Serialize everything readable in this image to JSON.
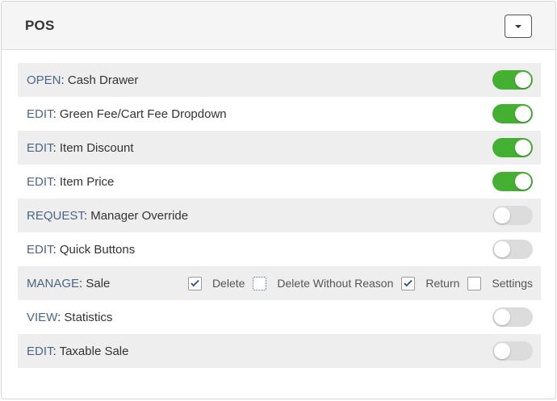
{
  "panel": {
    "title": "POS"
  },
  "permissions": [
    {
      "key": "OPEN",
      "name": "Cash Drawer",
      "enabled": true
    },
    {
      "key": "EDIT",
      "name": "Green Fee/Cart Fee Dropdown",
      "enabled": true
    },
    {
      "key": "EDIT",
      "name": "Item Discount",
      "enabled": true
    },
    {
      "key": "EDIT",
      "name": "Item Price",
      "enabled": true
    },
    {
      "key": "REQUEST",
      "name": "Manager Override",
      "enabled": false
    },
    {
      "key": "EDIT",
      "name": "Quick Buttons",
      "enabled": false
    },
    {
      "key": "MANAGE",
      "name": "Sale",
      "options": [
        {
          "label": "Delete",
          "checked": true
        },
        {
          "label": "Delete Without Reason",
          "checked": false
        },
        {
          "label": "Return",
          "checked": true
        },
        {
          "label": "Settings",
          "checked": false
        }
      ]
    },
    {
      "key": "VIEW",
      "name": "Statistics",
      "enabled": false
    },
    {
      "key": "EDIT",
      "name": "Taxable Sale",
      "enabled": false
    }
  ],
  "colors": {
    "toggle_on": "#44b032",
    "toggle_off": "#dcdcdc",
    "perm_key": "#4b6585"
  },
  "icons": {
    "dropdown": "caret-down-icon",
    "checkbox_checked": "checkmark-icon"
  }
}
